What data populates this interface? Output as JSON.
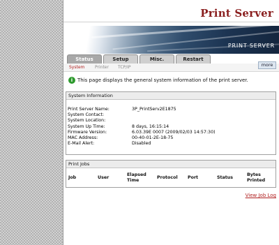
{
  "header": {
    "title": "Print Server"
  },
  "banner": {
    "logo_text": "PRINT SERVER"
  },
  "tabs": [
    {
      "label": "Status"
    },
    {
      "label": "Setup"
    },
    {
      "label": "Misc."
    },
    {
      "label": "Restart"
    }
  ],
  "subnav": {
    "system": "System",
    "printer": "Printer",
    "tcpip": "TCP/IP"
  },
  "more_label": "more",
  "info": {
    "icon_glyph": "i",
    "text": "This page displays the general system information of the print server."
  },
  "system_info": {
    "heading": "System Information",
    "rows": [
      {
        "label": "Print Server Name:",
        "value": "3P_PrintServ2E1875"
      },
      {
        "label": "System Contact:",
        "value": ""
      },
      {
        "label": "System Location:",
        "value": ""
      },
      {
        "label": "System Up Time:",
        "value": "8 days, 16:15:14"
      },
      {
        "label": "Firmware Version:",
        "value": "6.03.39E 0007 (2009/02/03 14:57:30)"
      },
      {
        "label": "MAC Address:",
        "value": "00-40-01-2E-18-75"
      },
      {
        "label": "E-Mail Alert:",
        "value": "Disabled"
      }
    ]
  },
  "print_jobs": {
    "heading": "Print Jobs",
    "columns": [
      "Job",
      "User",
      "Elapsed Time",
      "Protocol",
      "Port",
      "Status",
      "Bytes Printed"
    ]
  },
  "view_log_label": "View Job Log",
  "colors": {
    "title": "#8a1f1f",
    "link": "#b02020",
    "info_icon": "#2e9a2e"
  },
  "icons": {
    "info": "info-icon"
  }
}
